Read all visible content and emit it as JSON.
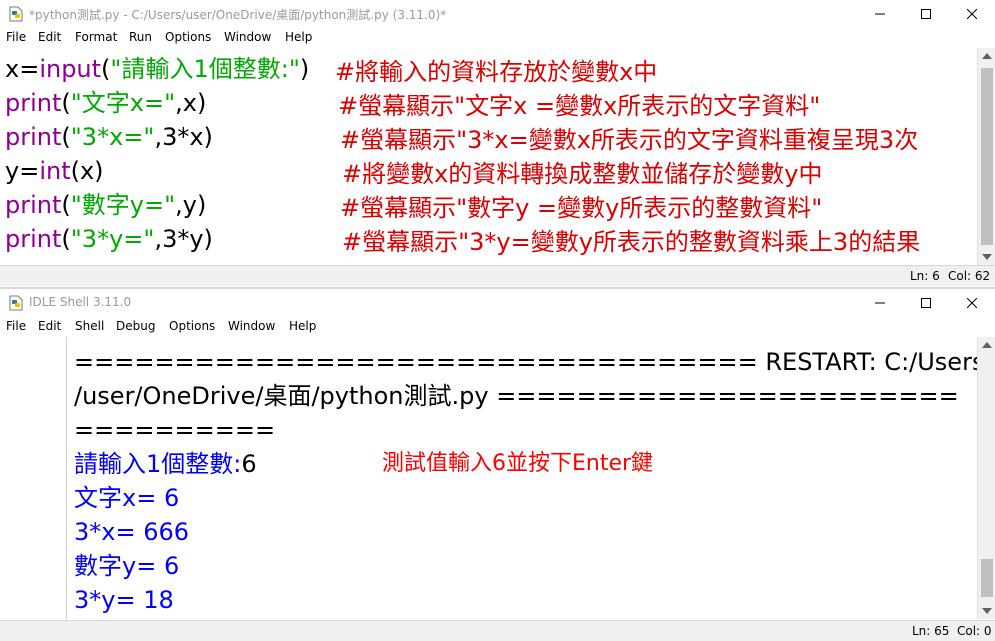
{
  "editor": {
    "title": "*python測試.py - C:/Users/user/OneDrive/桌面/python測試.py (3.11.0)*",
    "menu": [
      "File",
      "Edit",
      "Format",
      "Run",
      "Options",
      "Window",
      "Help"
    ],
    "lines": [
      {
        "code": [
          [
            "x=",
            "blk"
          ],
          [
            "input",
            "pur"
          ],
          [
            "(",
            "blk"
          ],
          [
            "\"請輸入1個整數:\"",
            "grn"
          ],
          [
            ")",
            "blk"
          ]
        ],
        "comment": "#將輸入的資料存放於變數x中"
      },
      {
        "code": [
          [
            "print",
            "pur"
          ],
          [
            "(",
            "blk"
          ],
          [
            "\"文字x=\"",
            "grn"
          ],
          [
            ",x)",
            "blk"
          ]
        ],
        "comment": "#螢幕顯示\"文字x =變數x所表示的文字資料\""
      },
      {
        "code": [
          [
            "print",
            "pur"
          ],
          [
            "(",
            "blk"
          ],
          [
            "\"3*x=\"",
            "grn"
          ],
          [
            ",3*x)",
            "blk"
          ]
        ],
        "comment": "#螢幕顯示\"3*x=變數x所表示的文字資料重複呈現3次"
      },
      {
        "code": [
          [
            "y=",
            "blk"
          ],
          [
            "int",
            "pur"
          ],
          [
            "(x)",
            "blk"
          ]
        ],
        "comment": "#將變數x的資料轉換成整數並儲存於變數y中"
      },
      {
        "code": [
          [
            "print",
            "pur"
          ],
          [
            "(",
            "blk"
          ],
          [
            "\"數字y=\"",
            "grn"
          ],
          [
            ",y)",
            "blk"
          ]
        ],
        "comment": "#螢幕顯示\"數字y =變數y所表示的整數資料\""
      },
      {
        "code": [
          [
            "print",
            "pur"
          ],
          [
            "(",
            "blk"
          ],
          [
            "\"3*y=\"",
            "grn"
          ],
          [
            ",3*y)",
            "blk"
          ]
        ],
        "comment": "#螢幕顯示\"3*y=變數y所表示的整數資料乘上3的結果"
      }
    ],
    "status": {
      "ln": "Ln: 6",
      "col": "Col: 62"
    }
  },
  "shell": {
    "title": "IDLE Shell 3.11.0",
    "menu": [
      "File",
      "Edit",
      "Shell",
      "Debug",
      "Options",
      "Window",
      "Help"
    ],
    "restart_line_1": "================================== RESTART: C:/Users",
    "restart_line_2": "/user/OneDrive/桌面/python測試.py =======================",
    "restart_line_3": "==========",
    "prompt": "請輸入1個整數:",
    "input_value": "6",
    "outputs": [
      "文字x= 6",
      "3*x= 666",
      "數字y= 6",
      "3*y= 18"
    ],
    "annotation": "測試值輸入6並按下Enter鍵",
    "status": {
      "ln": "Ln: 65",
      "col": "Col: 0"
    }
  },
  "colors": {
    "keyword": "#900090",
    "string": "#00aa00",
    "comment": "#dd0000",
    "stdout": "#0000ff",
    "annotation": "#ff0000"
  },
  "icons": {
    "editor_app": "python-file-icon",
    "shell_app": "idle-shell-icon",
    "minimize": "minimize-icon",
    "maximize": "maximize-icon",
    "close": "close-icon"
  }
}
